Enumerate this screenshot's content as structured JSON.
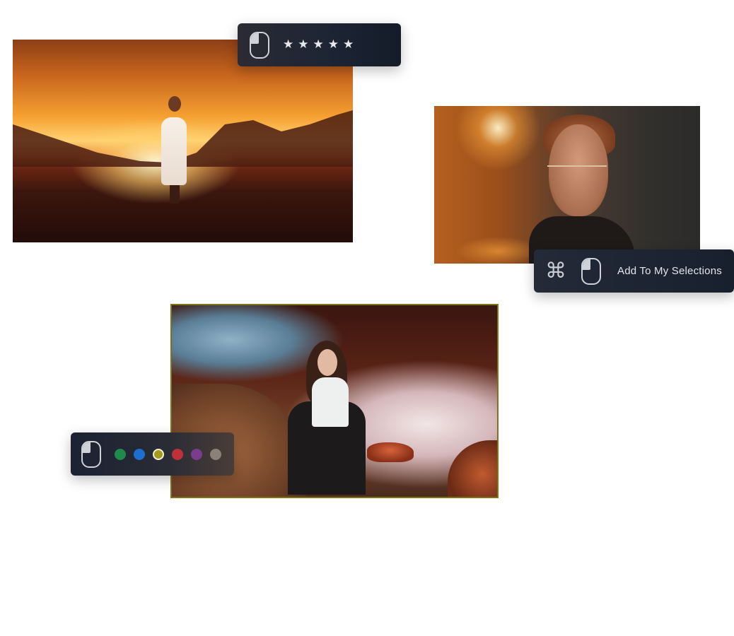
{
  "rating_toolbar": {
    "stars": [
      "★",
      "★",
      "★",
      "★",
      "★"
    ],
    "mouse_icon": "mouse-left-click-icon"
  },
  "selection_toolbar": {
    "command_glyph": "⌘",
    "mouse_icon": "mouse-left-click-icon",
    "label": "Add To My Selections"
  },
  "color_toolbar": {
    "mouse_icon": "mouse-left-click-icon",
    "colors": [
      {
        "name": "green",
        "hex": "#1f8a4c"
      },
      {
        "name": "blue",
        "hex": "#1c6fcf"
      },
      {
        "name": "yellow",
        "hex": "#a69a1e",
        "selected": true
      },
      {
        "name": "red",
        "hex": "#c0303a"
      },
      {
        "name": "purple",
        "hex": "#7a3d8e"
      },
      {
        "name": "gray",
        "hex": "#8a817a"
      }
    ]
  },
  "photos": {
    "selected_border_color": "#7d741a"
  }
}
